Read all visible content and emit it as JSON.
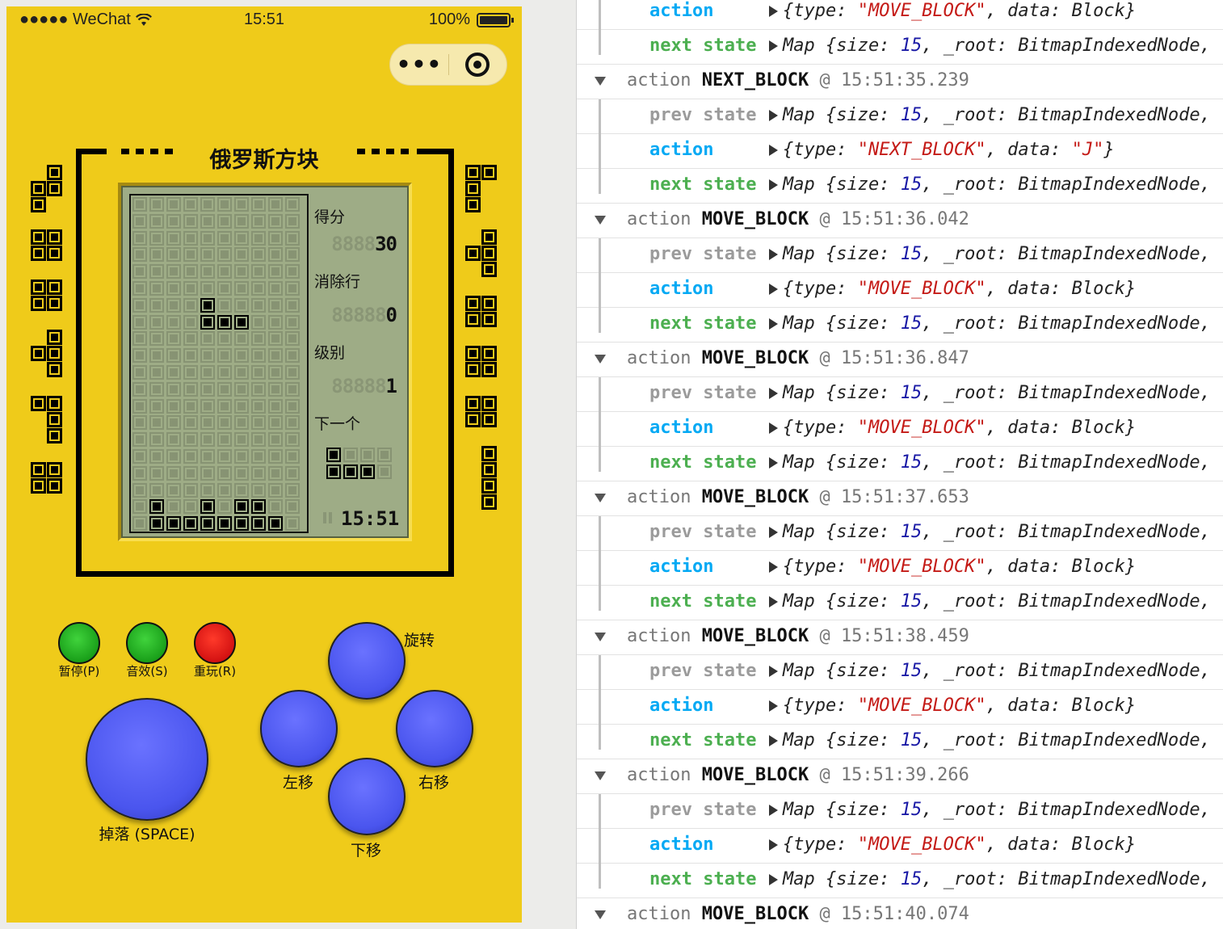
{
  "status_bar": {
    "carrier": "●●●●● WeChat",
    "time": "15:51",
    "battery": "100%"
  },
  "capsule": {
    "more": "•••"
  },
  "game": {
    "title": "俄罗斯方块",
    "score_label": "得分",
    "score_ghost": "8888",
    "score_value": "30",
    "lines_label": "消除行",
    "lines_ghost": "88888",
    "lines_value": "0",
    "level_label": "级别",
    "level_ghost": "88888",
    "level_value": "1",
    "next_label": "下一个",
    "clock": "15:51",
    "next_piece": [
      [
        1,
        0,
        0,
        0
      ],
      [
        1,
        1,
        1,
        0
      ]
    ],
    "board_cols": 10,
    "board_rows": 20,
    "filled_cells": [
      [
        6,
        4
      ],
      [
        7,
        4
      ],
      [
        7,
        5
      ],
      [
        7,
        6
      ],
      [
        18,
        1
      ],
      [
        18,
        4
      ],
      [
        18,
        6
      ],
      [
        18,
        7
      ],
      [
        19,
        1
      ],
      [
        19,
        2
      ],
      [
        19,
        3
      ],
      [
        19,
        4
      ],
      [
        19,
        5
      ],
      [
        19,
        6
      ],
      [
        19,
        7
      ],
      [
        19,
        8
      ]
    ]
  },
  "controls": {
    "pause": "暂停(P)",
    "sound": "音效(S)",
    "replay": "重玩(R)",
    "drop": "掉落 (SPACE)",
    "rotate": "旋转",
    "left": "左移",
    "right": "右移",
    "down": "下移"
  },
  "console": {
    "rows": [
      {
        "kind": "action",
        "label": "action",
        "obj": "{type: ",
        "str": "\"MOVE_BLOCK\"",
        "tail": ", data: Block}"
      },
      {
        "kind": "next",
        "label": "next state",
        "obj": "Map {size: ",
        "num": "15",
        "tail": ", _root: BitmapIndexedNode,"
      },
      {
        "kind": "group",
        "word": "action",
        "name": "NEXT_BLOCK",
        "at": "@",
        "time": "15:51:35.239"
      },
      {
        "kind": "prev",
        "label": "prev state",
        "obj": "Map {size: ",
        "num": "15",
        "tail": ", _root: BitmapIndexedNode,"
      },
      {
        "kind": "action",
        "label": "action",
        "obj": "{type: ",
        "str": "\"NEXT_BLOCK\"",
        "tail": ", data: ",
        "str2": "\"J\"",
        "tail2": "}"
      },
      {
        "kind": "next",
        "label": "next state",
        "obj": "Map {size: ",
        "num": "15",
        "tail": ", _root: BitmapIndexedNode,"
      },
      {
        "kind": "group",
        "word": "action",
        "name": "MOVE_BLOCK",
        "at": "@",
        "time": "15:51:36.042"
      },
      {
        "kind": "prev",
        "label": "prev state",
        "obj": "Map {size: ",
        "num": "15",
        "tail": ", _root: BitmapIndexedNode,"
      },
      {
        "kind": "action",
        "label": "action",
        "obj": "{type: ",
        "str": "\"MOVE_BLOCK\"",
        "tail": ", data: Block}"
      },
      {
        "kind": "next",
        "label": "next state",
        "obj": "Map {size: ",
        "num": "15",
        "tail": ", _root: BitmapIndexedNode,"
      },
      {
        "kind": "group",
        "word": "action",
        "name": "MOVE_BLOCK",
        "at": "@",
        "time": "15:51:36.847"
      },
      {
        "kind": "prev",
        "label": "prev state",
        "obj": "Map {size: ",
        "num": "15",
        "tail": ", _root: BitmapIndexedNode,"
      },
      {
        "kind": "action",
        "label": "action",
        "obj": "{type: ",
        "str": "\"MOVE_BLOCK\"",
        "tail": ", data: Block}"
      },
      {
        "kind": "next",
        "label": "next state",
        "obj": "Map {size: ",
        "num": "15",
        "tail": ", _root: BitmapIndexedNode,"
      },
      {
        "kind": "group",
        "word": "action",
        "name": "MOVE_BLOCK",
        "at": "@",
        "time": "15:51:37.653"
      },
      {
        "kind": "prev",
        "label": "prev state",
        "obj": "Map {size: ",
        "num": "15",
        "tail": ", _root: BitmapIndexedNode,"
      },
      {
        "kind": "action",
        "label": "action",
        "obj": "{type: ",
        "str": "\"MOVE_BLOCK\"",
        "tail": ", data: Block}"
      },
      {
        "kind": "next",
        "label": "next state",
        "obj": "Map {size: ",
        "num": "15",
        "tail": ", _root: BitmapIndexedNode,"
      },
      {
        "kind": "group",
        "word": "action",
        "name": "MOVE_BLOCK",
        "at": "@",
        "time": "15:51:38.459"
      },
      {
        "kind": "prev",
        "label": "prev state",
        "obj": "Map {size: ",
        "num": "15",
        "tail": ", _root: BitmapIndexedNode,"
      },
      {
        "kind": "action",
        "label": "action",
        "obj": "{type: ",
        "str": "\"MOVE_BLOCK\"",
        "tail": ", data: Block}"
      },
      {
        "kind": "next",
        "label": "next state",
        "obj": "Map {size: ",
        "num": "15",
        "tail": ", _root: BitmapIndexedNode,"
      },
      {
        "kind": "group",
        "word": "action",
        "name": "MOVE_BLOCK",
        "at": "@",
        "time": "15:51:39.266"
      },
      {
        "kind": "prev",
        "label": "prev state",
        "obj": "Map {size: ",
        "num": "15",
        "tail": ", _root: BitmapIndexedNode,"
      },
      {
        "kind": "action",
        "label": "action",
        "obj": "{type: ",
        "str": "\"MOVE_BLOCK\"",
        "tail": ", data: Block}"
      },
      {
        "kind": "next",
        "label": "next state",
        "obj": "Map {size: ",
        "num": "15",
        "tail": ", _root: BitmapIndexedNode,"
      },
      {
        "kind": "group",
        "word": "action",
        "name": "MOVE_BLOCK",
        "at": "@",
        "time": "15:51:40.074"
      }
    ]
  }
}
